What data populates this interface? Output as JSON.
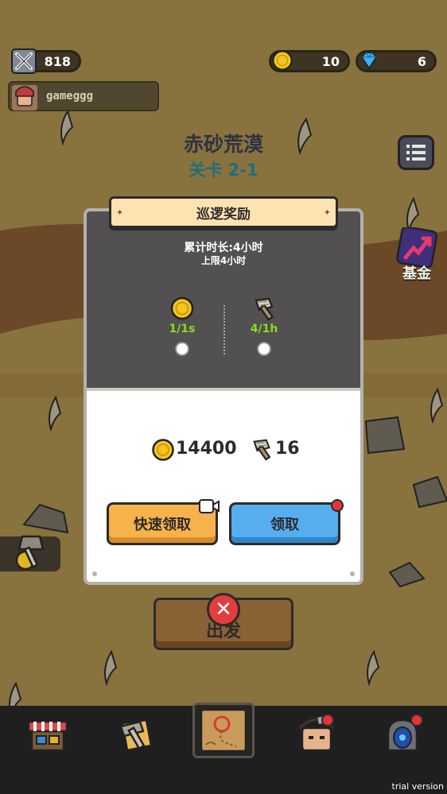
{
  "hud": {
    "power": "818",
    "gold": "10",
    "gems": "6",
    "username": "gameggg"
  },
  "stage": {
    "name": "赤砂荒漠",
    "level": "关卡 2-1"
  },
  "side": {
    "fund_label": "基金"
  },
  "patrol": {
    "title": "巡逻奖励",
    "accumulated": "累计时长:4小时",
    "cap": "上限4小时",
    "rates": [
      {
        "icon": "gold-coin-icon",
        "label": "1/1s"
      },
      {
        "icon": "hammer-material-icon",
        "label": "4/1h"
      }
    ],
    "total_gold": "14400",
    "total_material": "16",
    "quick_claim_label": "快速领取",
    "claim_label": "领取",
    "depart_label": "出发"
  },
  "watermark": "trial version",
  "colors": {
    "modal_top": "#525050",
    "banner": "#fde3b1",
    "quick_button": "#f7b24b",
    "claim_button": "#56aeee",
    "rate_text": "#8bdc1f",
    "badge": "#e53434"
  }
}
